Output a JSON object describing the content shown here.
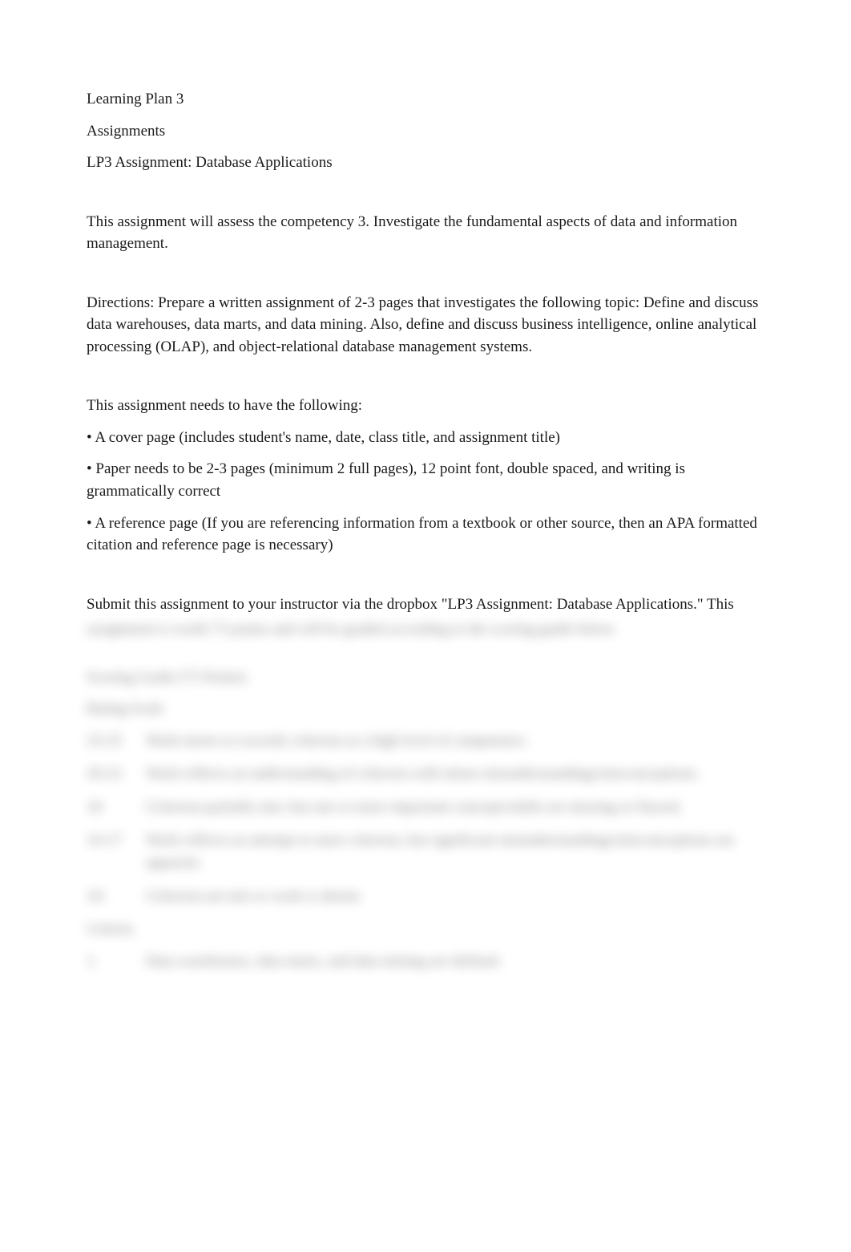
{
  "heading1": "Learning Plan 3",
  "heading2": "Assignments",
  "heading3": "LP3 Assignment: Database Applications",
  "competency": "This assignment will assess the competency 3. Investigate the fundamental aspects of data and information management.",
  "directions": "Directions: Prepare a written assignment of 2-3 pages that investigates the following topic: Define and discuss data warehouses, data marts, and data mining. Also, define and discuss business intelligence, online analytical processing (OLAP), and object-relational database management systems.",
  "needs_intro": "This assignment needs to have the following:",
  "bullets": [
    "• A cover page (includes student's name, date, class title, and assignment title)",
    "• Paper needs to be 2-3 pages (minimum 2 full pages), 12 point font, double spaced, and writing is grammatically correct",
    "• A reference page (If you are referencing information from a textbook or other source, then an APA formatted citation and reference page is necessary)"
  ],
  "submit_visible": "Submit this assignment to your instructor via the dropbox \"LP3 Assignment: Database Applications.\" This",
  "blurred": {
    "submit_rest": "assignment is worth 75 points and will be graded according to the scoring guide below.",
    "scoring_title": "Scoring Guide (75 Points)",
    "rating_scale": "Rating Scale",
    "rows": [
      {
        "pts": "23-25",
        "desc": "Work meets or exceeds criterion at a high level of competence."
      },
      {
        "pts": "20-22",
        "desc": "Work reflects an understanding of criterion with minor misunderstandings/misconceptions."
      },
      {
        "pts": "18",
        "desc": "Criterion partially met, but one or more important concepts/skills are missing or flawed."
      },
      {
        "pts": "14-17",
        "desc": "Work reflects an attempt to meet criterion, but significant misunderstandings/misconceptions are apparent."
      },
      {
        "pts": "10-",
        "desc": "Criterion not met or work is absent."
      }
    ],
    "criteria_label": "Criteria",
    "criteria1": {
      "pts": "1.",
      "desc": "Data warehouses, data marts, and data mining are defined."
    }
  }
}
